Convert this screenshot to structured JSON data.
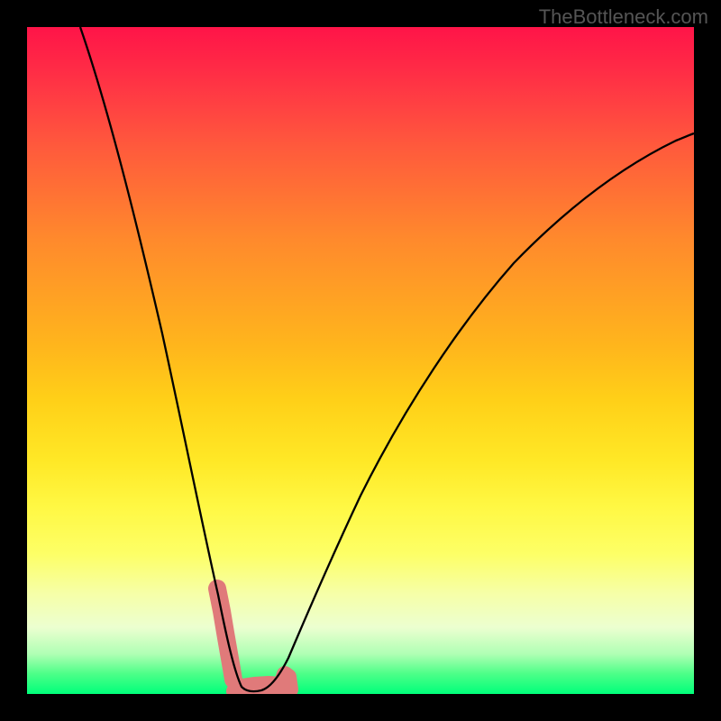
{
  "watermark": "TheBottleneck.com",
  "chart_data": {
    "type": "line",
    "title": "",
    "xlabel": "",
    "ylabel": "",
    "xlim": [
      0,
      100
    ],
    "ylim": [
      0,
      100
    ],
    "series": [
      {
        "name": "bottleneck-curve",
        "x": [
          8,
          12,
          16,
          20,
          24,
          27,
          29,
          30.5,
          32,
          34,
          36,
          38,
          40,
          44,
          50,
          58,
          66,
          74,
          82,
          90,
          98,
          100
        ],
        "values": [
          100,
          88,
          72,
          54,
          36,
          20,
          10,
          3,
          0.5,
          0.5,
          1,
          3,
          7,
          16,
          30,
          46,
          58,
          67,
          74,
          79,
          83,
          84
        ]
      }
    ],
    "highlights": [
      {
        "name": "left-highlight",
        "x_range": [
          28.5,
          30.5
        ],
        "y_range": [
          3,
          16
        ]
      },
      {
        "name": "bottom-highlight",
        "x_range": [
          31.0,
          38.5
        ],
        "y_range": [
          0,
          4
        ]
      }
    ],
    "gradient_stops": [
      {
        "pct": 0,
        "color": "#ff1448"
      },
      {
        "pct": 25,
        "color": "#ff7234"
      },
      {
        "pct": 56,
        "color": "#ffd018"
      },
      {
        "pct": 79,
        "color": "#fdff66"
      },
      {
        "pct": 94,
        "color": "#b0ffb4"
      },
      {
        "pct": 100,
        "color": "#00ff7a"
      }
    ]
  }
}
